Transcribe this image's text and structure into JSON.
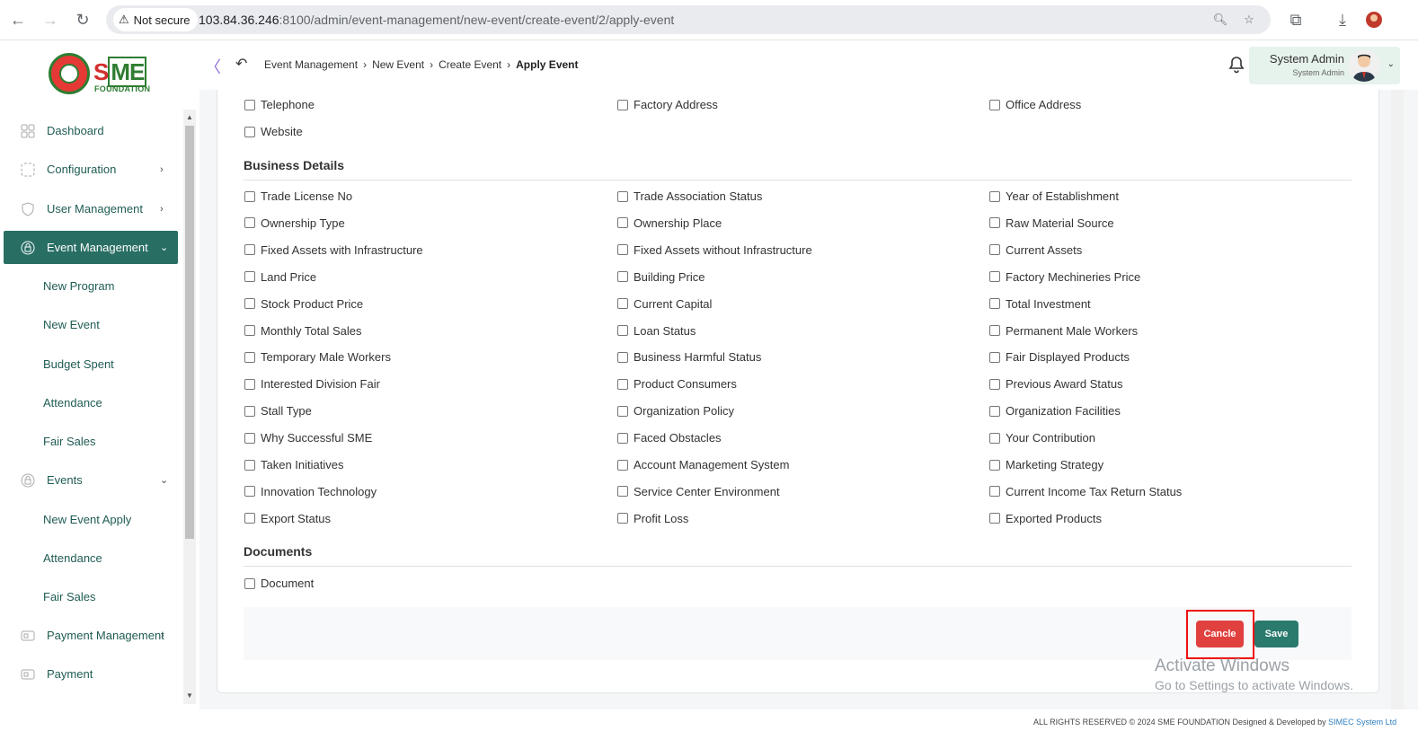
{
  "browser": {
    "security_label": "Not secure",
    "url_host": "103.84.36.246",
    "url_rest": ":8100/admin/event-management/new-event/create-event/2/apply-event"
  },
  "logo": {
    "text_s": "S",
    "text_me": "ME",
    "subtitle": "FOUNDATION"
  },
  "breadcrumb": [
    "Event Management",
    "New Event",
    "Create Event",
    "Apply Event"
  ],
  "user": {
    "name": "System Admin",
    "role": "System Admin"
  },
  "sidebar": {
    "items": [
      {
        "label": "Dashboard",
        "icon": "grid-icon"
      },
      {
        "label": "Configuration",
        "icon": "config-icon",
        "chevron": "›"
      },
      {
        "label": "User Management",
        "icon": "shield-icon",
        "chevron": "›"
      },
      {
        "label": "Event Management",
        "icon": "lock-icon",
        "chevron": "⌄",
        "active": true
      },
      {
        "label": "Events",
        "icon": "lock-icon",
        "chevron": "⌄"
      },
      {
        "label": "Payment Management",
        "icon": "card-icon",
        "chevron": "›"
      },
      {
        "label": "Payment",
        "icon": "card-icon"
      }
    ],
    "event_management_sub": [
      "New Program",
      "New Event",
      "Budget Spent",
      "Attendance",
      "Fair Sales"
    ],
    "events_sub": [
      "New Event Apply",
      "Attendance",
      "Fair Sales"
    ]
  },
  "contact_fields": [
    "Telephone",
    "Factory Address",
    "Office Address",
    "Website"
  ],
  "business_title": "Business Details",
  "business_fields": [
    "Trade License No",
    "Trade Association Status",
    "Year of Establishment",
    "Ownership Type",
    "Ownership Place",
    "Raw Material Source",
    "Fixed Assets with Infrastructure",
    "Fixed Assets without Infrastructure",
    "Current Assets",
    "Land Price",
    "Building Price",
    "Factory Mechineries Price",
    "Stock Product Price",
    "Current Capital",
    "Total Investment",
    "Monthly Total Sales",
    "Loan Status",
    "Permanent Male Workers",
    "Temporary Male Workers",
    "Business Harmful Status",
    "Fair Displayed Products",
    "Interested Division Fair",
    "Product Consumers",
    "Previous Award Status",
    "Stall Type",
    "Organization Policy",
    "Organization Facilities",
    "Why Successful SME",
    "Faced Obstacles",
    "Your Contribution",
    "Taken Initiatives",
    "Account Management System",
    "Marketing Strategy",
    "Innovation Technology",
    "Service Center Environment",
    "Current Income Tax Return Status",
    "Export Status",
    "Profit Loss",
    "Exported Products"
  ],
  "documents_title": "Documents",
  "document_fields": [
    "Document"
  ],
  "actions": {
    "cancel_label": "Cancle",
    "save_label": "Save"
  },
  "watermark": {
    "line1": "Activate Windows",
    "line2": "Go to Settings to activate Windows."
  },
  "footer": {
    "text": "ALL RIGHTS RESERVED © 2024 SME FOUNDATION   Designed & Developed by ",
    "link": "SIMEC System Ltd"
  },
  "colors": {
    "accent": "#286e63",
    "cancel": "#e0413f",
    "save": "#2a7a6e",
    "highlight": "#e11111"
  }
}
